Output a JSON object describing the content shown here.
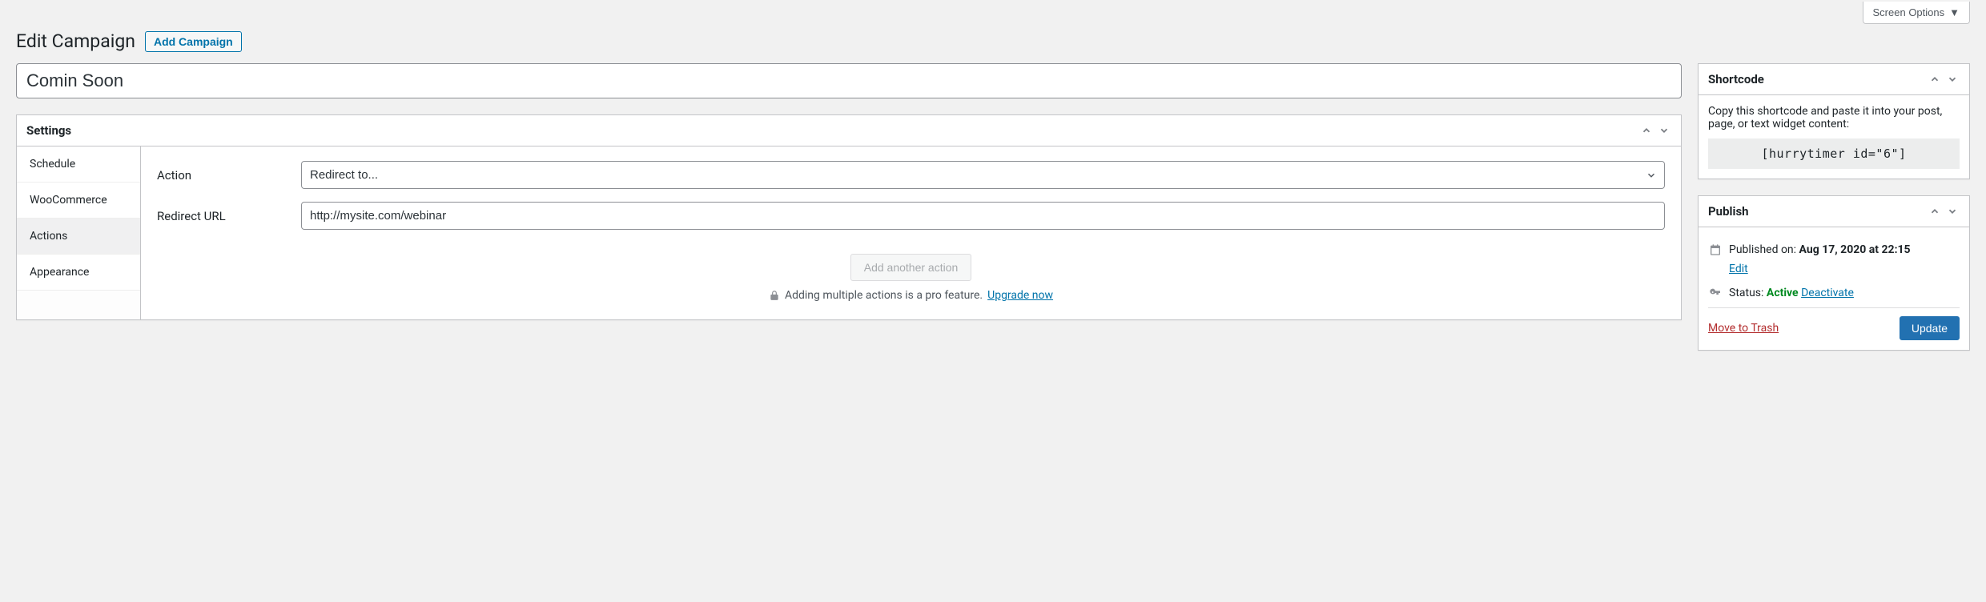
{
  "screen_options_label": "Screen Options",
  "page_title": "Edit Campaign",
  "add_button_label": "Add Campaign",
  "title_field_value": "Comin Soon",
  "settings": {
    "box_title": "Settings",
    "tabs": {
      "schedule": "Schedule",
      "woocommerce": "WooCommerce",
      "actions": "Actions",
      "appearance": "Appearance"
    },
    "active_tab": "actions",
    "action_label": "Action",
    "action_selected": "Redirect to...",
    "redirect_url_label": "Redirect URL",
    "redirect_url_value": "http://mysite.com/webinar",
    "add_another_label": "Add another action",
    "pro_text": "Adding multiple actions is a pro feature.",
    "upgrade_link": "Upgrade now"
  },
  "shortcode": {
    "box_title": "Shortcode",
    "help_text": "Copy this shortcode and paste it into your post, page, or text widget content:",
    "code": "[hurrytimer id=\"6\"]"
  },
  "publish": {
    "box_title": "Publish",
    "published_label": "Published on:",
    "published_value": "Aug 17, 2020 at 22:15",
    "edit_label": "Edit",
    "status_label": "Status:",
    "status_value": "Active",
    "deactivate_label": "Deactivate",
    "trash_label": "Move to Trash",
    "update_label": "Update"
  }
}
